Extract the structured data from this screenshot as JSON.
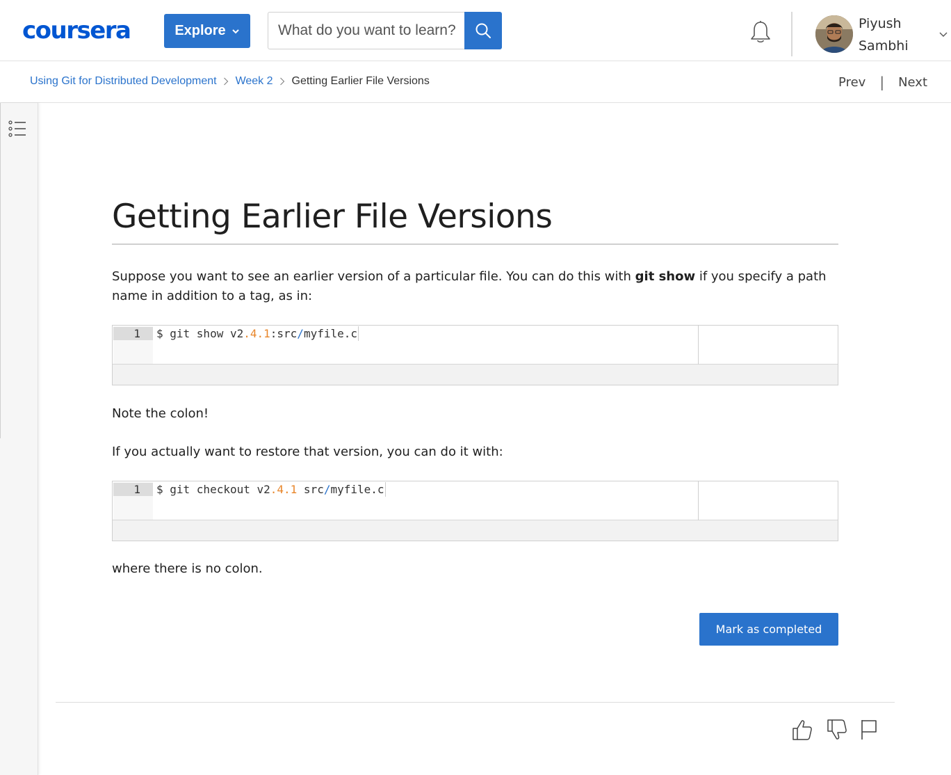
{
  "header": {
    "logo_text": "coursera",
    "explore_label": "Explore",
    "search_placeholder": "What do you want to learn?",
    "user": {
      "first_name": "Piyush",
      "last_name": "Sambhi"
    }
  },
  "breadcrumb": {
    "items": [
      {
        "label": "Using Git for Distributed Development"
      },
      {
        "label": "Week 2"
      },
      {
        "label": "Getting Earlier File Versions"
      }
    ],
    "prev_label": "Prev",
    "next_label": "Next",
    "separator": "|"
  },
  "content": {
    "title": "Getting Earlier File Versions",
    "para1_before": "Suppose you want to see an earlier version of a particular file. You can do this with ",
    "para1_bold": "git show",
    "para1_after": " if you specify a path name in addition to a tag, as in:",
    "code1": {
      "line_number": "1",
      "prefix": "$ git show v2",
      "version": ".4.1",
      "middle": ":src",
      "slash": "/",
      "suffix": "myfile.c"
    },
    "note": "Note the colon!",
    "para2": "If you actually want to restore that version, you can do it with:",
    "code2": {
      "line_number": "1",
      "prefix": "$ git checkout v2",
      "version": ".4.1",
      "middle": " src",
      "slash": "/",
      "suffix": "myfile.c"
    },
    "closing": "where there is no colon.",
    "mark_completed_label": "Mark as completed"
  },
  "colors": {
    "brand_blue": "#0056d2",
    "button_blue": "#2a73cc",
    "code_number_orange": "#e8862a"
  },
  "icons": [
    "search-icon",
    "bell-icon",
    "chevron-down-icon",
    "chevron-right-icon",
    "toc-list-icon",
    "thumbs-up-icon",
    "thumbs-down-icon",
    "flag-icon"
  ]
}
